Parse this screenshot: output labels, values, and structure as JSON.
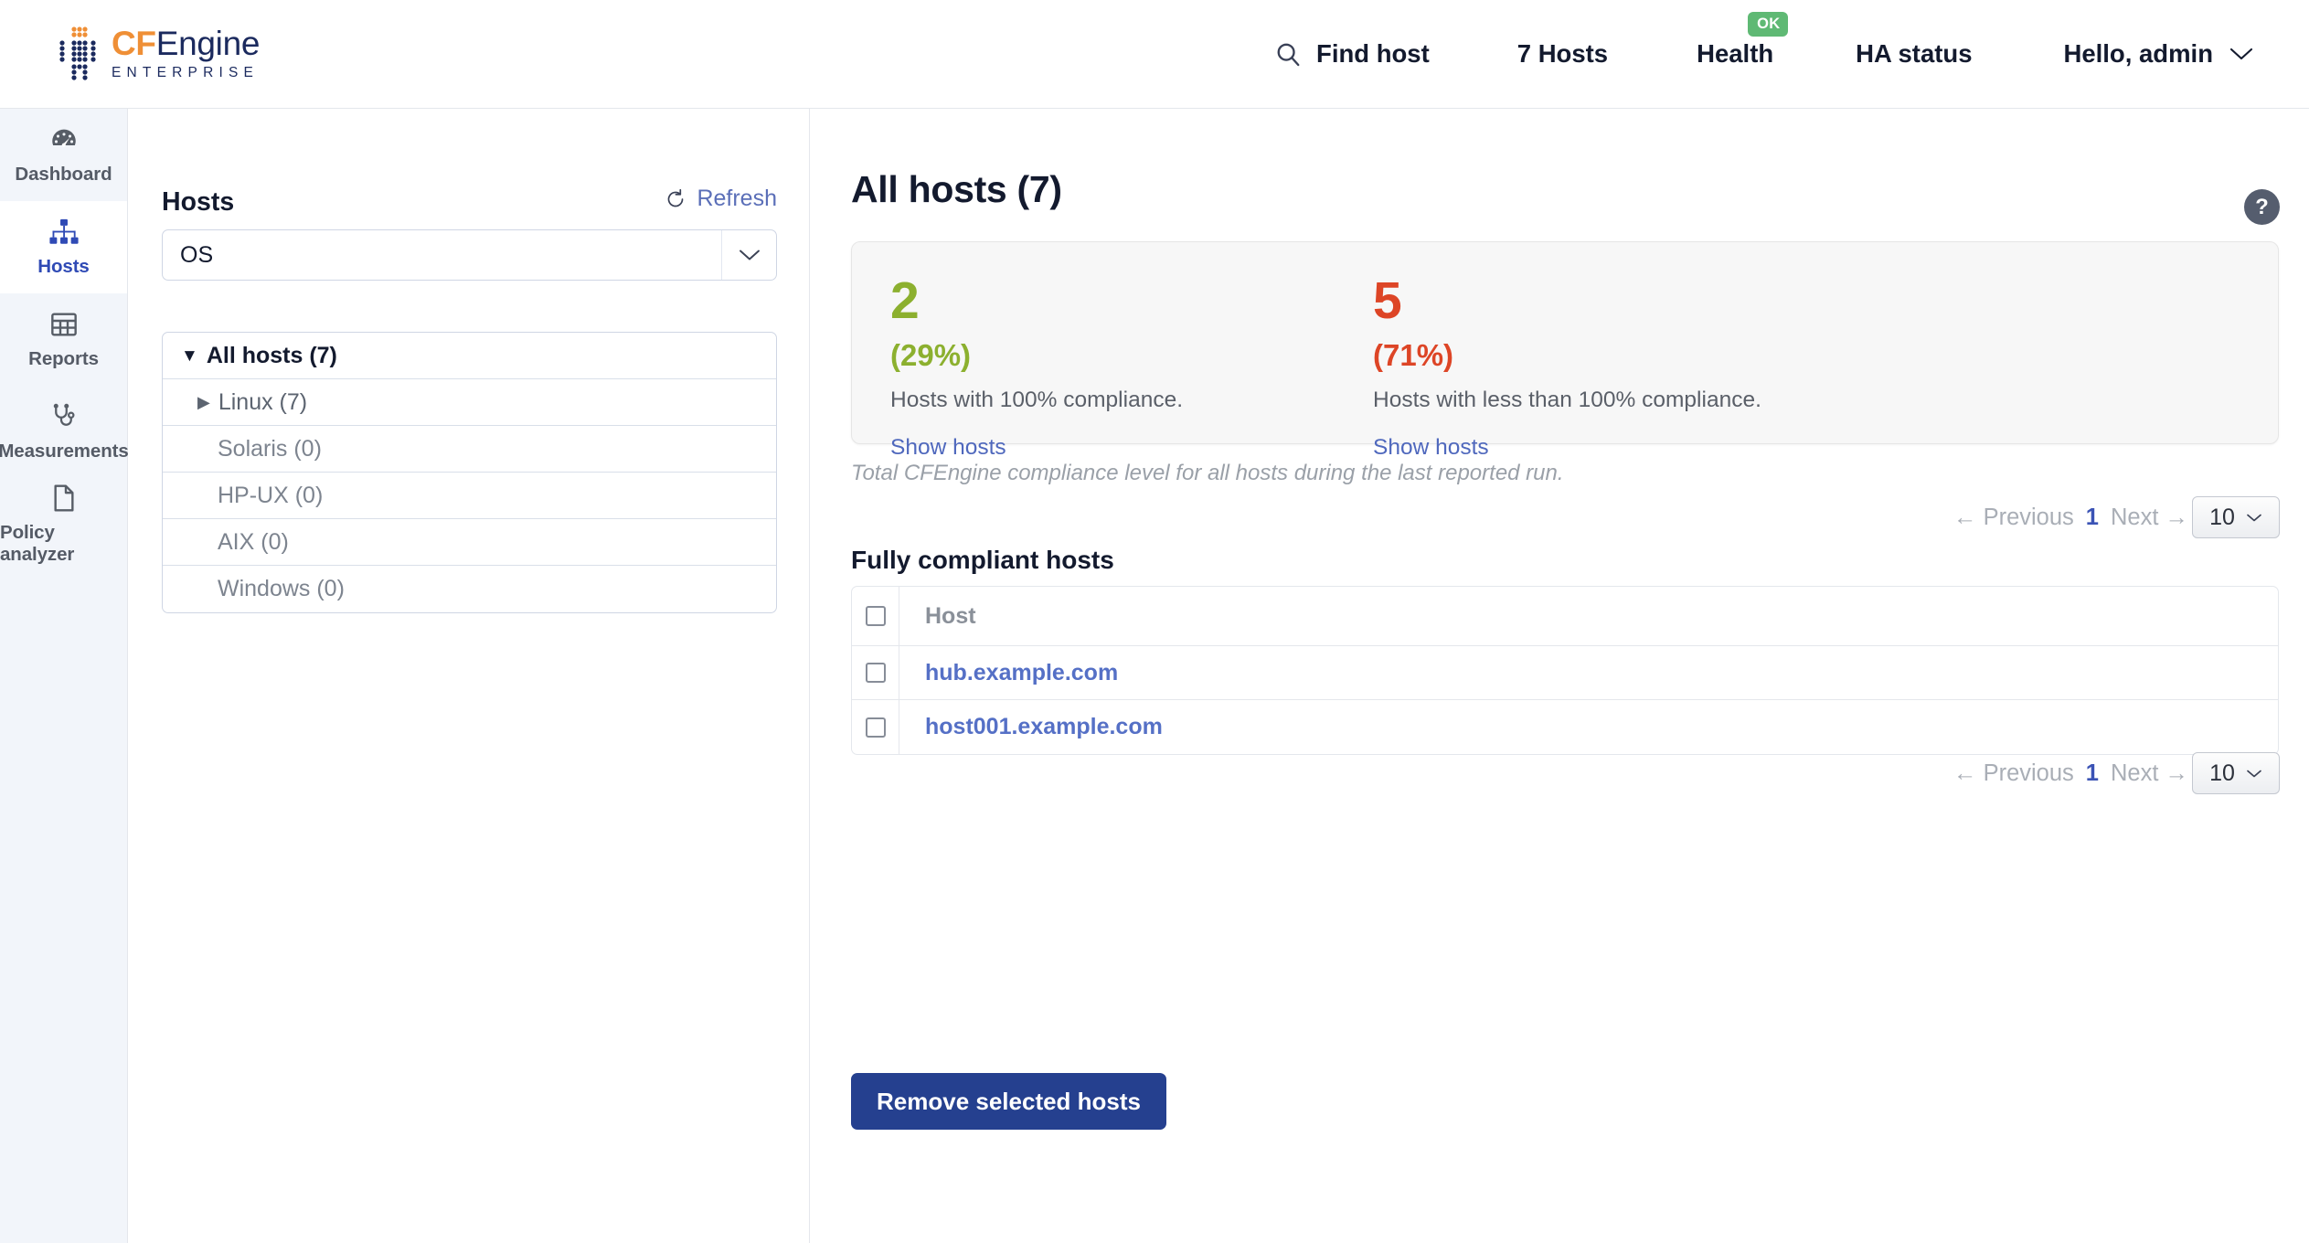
{
  "brand": {
    "name_cf": "CF",
    "name_engine": "Engine",
    "edition": "ENTERPRISE",
    "color_orange": "#ef8f36",
    "color_navy": "#1b2a5e"
  },
  "header": {
    "find_host": "Find host",
    "hosts_count": "7 Hosts",
    "health": "Health",
    "health_badge": "OK",
    "health_badge_color": "#5fb974",
    "ha_status": "HA status",
    "user": "Hello, admin"
  },
  "sidebar": {
    "items": [
      {
        "label": "Dashboard",
        "icon": "gauge-icon",
        "active": false
      },
      {
        "label": "Hosts",
        "icon": "sitemap-icon",
        "active": true
      },
      {
        "label": "Reports",
        "icon": "table-icon",
        "active": false
      },
      {
        "label": "Measurements",
        "icon": "stethoscope-icon",
        "active": false
      },
      {
        "label": "Policy analyzer",
        "icon": "document-icon",
        "active": false
      }
    ],
    "active_color": "#2f4ab5"
  },
  "filter_panel": {
    "title": "Hosts",
    "refresh_label": "Refresh",
    "os_select_value": "OS",
    "tree": [
      {
        "label": "All hosts (7)",
        "level": 0,
        "marker": "down"
      },
      {
        "label": "Linux (7)",
        "level": 1,
        "marker": "right"
      },
      {
        "label": "Solaris (0)",
        "level": 1,
        "marker": "none"
      },
      {
        "label": "HP-UX (0)",
        "level": 1,
        "marker": "none"
      },
      {
        "label": "AIX (0)",
        "level": 1,
        "marker": "none"
      },
      {
        "label": "Windows (0)",
        "level": 1,
        "marker": "none"
      }
    ]
  },
  "main": {
    "page_title": "All hosts (7)",
    "help_glyph": "?",
    "summary": {
      "compliant": {
        "count": "2",
        "percent": "(29%)",
        "description": "Hosts with 100% compliance.",
        "link": "Show hosts",
        "color": "#8cb02f"
      },
      "noncompliant": {
        "count": "5",
        "percent": "(71%)",
        "description": "Hosts with less than 100% compliance.",
        "link": "Show hosts",
        "color": "#dd4526"
      },
      "caption": "Total CFEngine compliance level for all hosts during the last reported run."
    },
    "pagination_top": {
      "previous": "← Previous",
      "current_page": "1",
      "next": "Next →",
      "page_size": "10"
    },
    "pagination_bottom": {
      "previous": "← Previous",
      "current_page": "1",
      "next": "Next →",
      "page_size": "10"
    },
    "table": {
      "title": "Fully compliant hosts",
      "column_header": "Host",
      "rows": [
        {
          "host": "hub.example.com"
        },
        {
          "host": "host001.example.com"
        }
      ]
    },
    "remove_button": "Remove selected hosts"
  }
}
